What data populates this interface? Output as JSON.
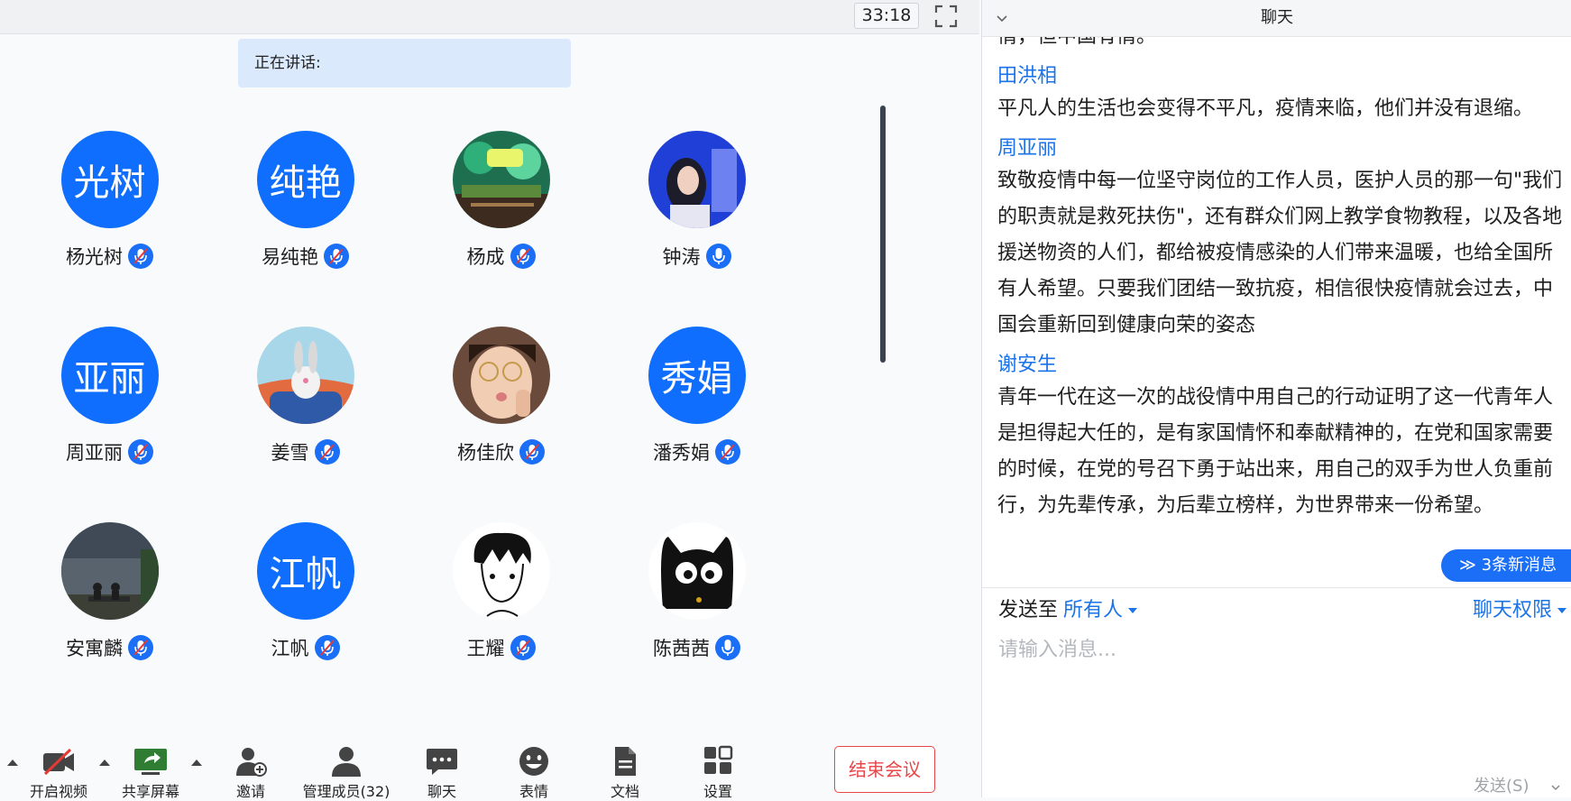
{
  "meeting": {
    "timer": "33:18",
    "speaking_label": "正在讲话:",
    "participants": [
      {
        "name": "杨光树",
        "avatar_text": "光树",
        "avatar": "text",
        "mic": "muted"
      },
      {
        "name": "易纯艳",
        "avatar_text": "纯艳",
        "avatar": "text",
        "mic": "muted"
      },
      {
        "name": "杨成",
        "avatar_text": "",
        "avatar": "image-green-cartoon",
        "mic": "muted"
      },
      {
        "name": "钟涛",
        "avatar_text": "",
        "avatar": "image-girl-blue",
        "mic": "on"
      },
      {
        "name": "周亚丽",
        "avatar_text": "亚丽",
        "avatar": "text",
        "mic": "muted"
      },
      {
        "name": "姜雪",
        "avatar_text": "",
        "avatar": "image-rabbit-cartoon",
        "mic": "muted"
      },
      {
        "name": "杨佳欣",
        "avatar_text": "",
        "avatar": "image-child-glasses",
        "mic": "muted"
      },
      {
        "name": "潘秀娟",
        "avatar_text": "秀娟",
        "avatar": "text",
        "mic": "muted"
      },
      {
        "name": "安寓麟",
        "avatar_text": "",
        "avatar": "image-lakeside-bench",
        "mic": "muted"
      },
      {
        "name": "江帆",
        "avatar_text": "江帆",
        "avatar": "text",
        "mic": "muted"
      },
      {
        "name": "王耀",
        "avatar_text": "",
        "avatar": "image-sketch-boy",
        "mic": "muted"
      },
      {
        "name": "陈茜茜",
        "avatar_text": "",
        "avatar": "image-black-cat",
        "mic": "on"
      }
    ],
    "toolbar": {
      "video": "开启视频",
      "share": "共享屏幕",
      "invite": "邀请",
      "members": "管理成员(32)",
      "chat": "聊天",
      "emoji": "表情",
      "docs": "文档",
      "settings": "设置",
      "end": "结束会议"
    },
    "colors": {
      "accent": "#1a6ff6",
      "avatar_bg": "#0f6efd",
      "end_button": "#e8474a"
    }
  },
  "chat": {
    "title": "聊天",
    "partial_top": "情，但中国有情。",
    "messages": [
      {
        "sender": "田洪相",
        "text": "平凡人的生活也会变得不平凡，疫情来临，他们并没有退缩。"
      },
      {
        "sender": "周亚丽",
        "text": "致敬疫情中每一位坚守岗位的工作人员，医护人员的那一句\"我们的职责就是救死扶伤\"，还有群众们网上教学食物教程，以及各地援送物资的人们，都给被疫情感染的人们带来温暖，也给全国所有人希望。只要我们团结一致抗疫，相信很快疫情就会过去，中国会重新回到健康向荣的姿态"
      },
      {
        "sender": "谢安生",
        "text": "青年一代在这一次的战役情中用自己的行动证明了这一代青年人是担得起大任的，是有家国情怀和奉献精神的，在党和国家需要的时候，在党的号召下勇于站出来，用自己的双手为世人负重前行，为先辈传承，为后辈立榜样，为世界带来一份希望。"
      }
    ],
    "new_messages": "3条新消息",
    "send_to_label": "发送至",
    "send_to_value": "所有人",
    "permissions": "聊天权限",
    "input_placeholder": "请输入消息...",
    "send_button": "发送(S)"
  }
}
